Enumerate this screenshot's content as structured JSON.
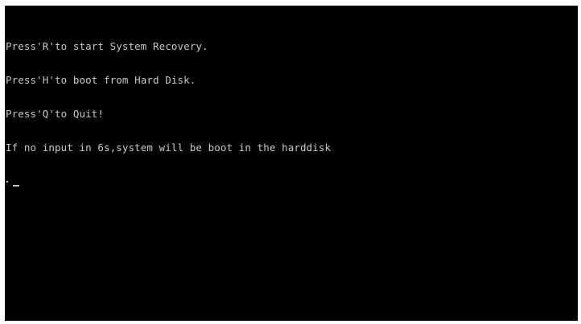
{
  "console": {
    "lines": [
      "Press'R'to start System Recovery.",
      "Press'H'to boot from Hard Disk.",
      "Press'Q'to Quit!",
      "If no input in 6s,system will be boot in the harddisk"
    ]
  },
  "colors": {
    "background": "#000000",
    "text": "#c8c8c8",
    "border": "#ffffff"
  }
}
